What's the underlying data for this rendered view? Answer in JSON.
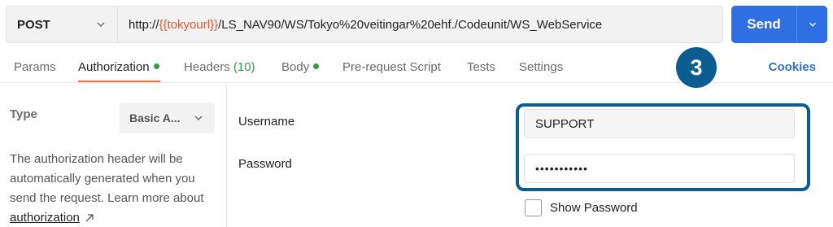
{
  "request": {
    "method": "POST",
    "url_prefix": "http://",
    "url_variable": "{{tokyourl}}",
    "url_suffix": "/LS_NAV90/WS/Tokyo%20veitingar%20ehf./Codeunit/WS_WebService",
    "send_label": "Send"
  },
  "tabs": [
    {
      "label": "Params"
    },
    {
      "label": "Authorization",
      "indicator": true,
      "active": true
    },
    {
      "label": "Headers",
      "count": "(10)"
    },
    {
      "label": "Body",
      "indicator": true
    },
    {
      "label": "Pre-request Script"
    },
    {
      "label": "Tests"
    },
    {
      "label": "Settings"
    }
  ],
  "cookies_label": "Cookies",
  "callout_number": "3",
  "auth": {
    "type_label": "Type",
    "type_value": "Basic A...",
    "description": "The authorization header will be automatically generated when you send the request. Learn more about",
    "link_text": "authorization"
  },
  "fields": {
    "username_label": "Username",
    "username_value": "SUPPORT",
    "password_label": "Password",
    "password_value": "•••••••••••",
    "show_password_label": "Show Password"
  },
  "colors": {
    "accent": "#2f6fe4",
    "active_tab_underline": "#ff6c37",
    "indicator": "#2e9d4c",
    "callout": "#0b5d8f",
    "variable": "#e0592f"
  }
}
